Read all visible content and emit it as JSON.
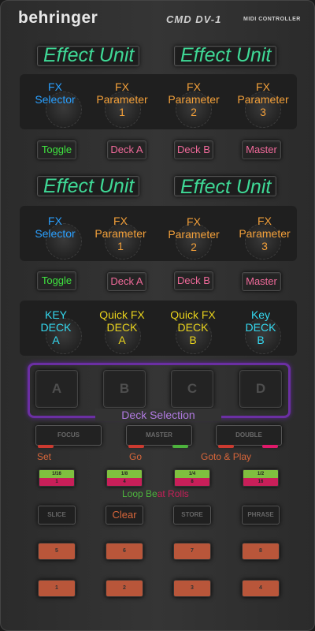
{
  "brand": "behringer",
  "model": "CMD DV-1",
  "model_sub": "MIDI CONTROLLER",
  "section1": {
    "titles": [
      "Effect Unit",
      "Effect Unit"
    ],
    "knobs": [
      {
        "label": "FX\nSelector",
        "color": "#2aa0ff"
      },
      {
        "label": "FX\nParameter\n1",
        "color": "#f3a03a"
      },
      {
        "label": "FX\nParameter\n2",
        "color": "#f3a03a"
      },
      {
        "label": "FX\nParameter\n3",
        "color": "#f3a03a"
      }
    ],
    "buttons": [
      "Toggle",
      "Deck A",
      "Deck B",
      "Master"
    ]
  },
  "section2": {
    "titles": [
      "Effect Unit",
      "Effect Unit"
    ],
    "knobs": [
      {
        "label": "FX\nSelector",
        "color": "#2aa0ff"
      },
      {
        "label": "FX\nParameter\n1",
        "color": "#f3a03a"
      },
      {
        "label": "FX\nParameter\n2",
        "color": "#f3a03a"
      },
      {
        "label": "FX\nParameter\n3",
        "color": "#f3a03a"
      }
    ],
    "buttons": [
      "Toggle",
      "Deck A",
      "Deck B",
      "Master"
    ]
  },
  "section3": {
    "knobs": [
      {
        "label": "KEY\nDECK\nA",
        "color": "#34d9f0"
      },
      {
        "label": "Quick FX\nDECK\nA",
        "color": "#e8d21c"
      },
      {
        "label": "Quick FX\nDECK\nB",
        "color": "#e8d21c"
      },
      {
        "label": "Key\nDECK\nB",
        "color": "#34d9f0"
      }
    ]
  },
  "deck_selection": {
    "pads": [
      "A",
      "B",
      "C",
      "D"
    ],
    "label": "Deck Selection"
  },
  "mode_buttons": [
    {
      "label": "FOCUS",
      "sub": "Set"
    },
    {
      "label": "MASTER",
      "sub": "Go"
    },
    {
      "label": "DOUBLE",
      "sub": "Goto & Play"
    }
  ],
  "loop_rolls": {
    "buttons": [
      {
        "top": "1/16",
        "bottom": "1"
      },
      {
        "top": "1/8",
        "bottom": "4"
      },
      {
        "top": "1/4",
        "bottom": "8"
      },
      {
        "top": "1/2",
        "bottom": "16"
      }
    ],
    "label_parts": [
      "Loop Be",
      "at Rolls"
    ]
  },
  "function_buttons": [
    "SLICE",
    "Clear",
    "STORE",
    "PHRASE"
  ],
  "hotcue_row1": [
    "5",
    "6",
    "7",
    "8"
  ],
  "hotcue_row2": [
    "1",
    "2",
    "3",
    "4"
  ]
}
